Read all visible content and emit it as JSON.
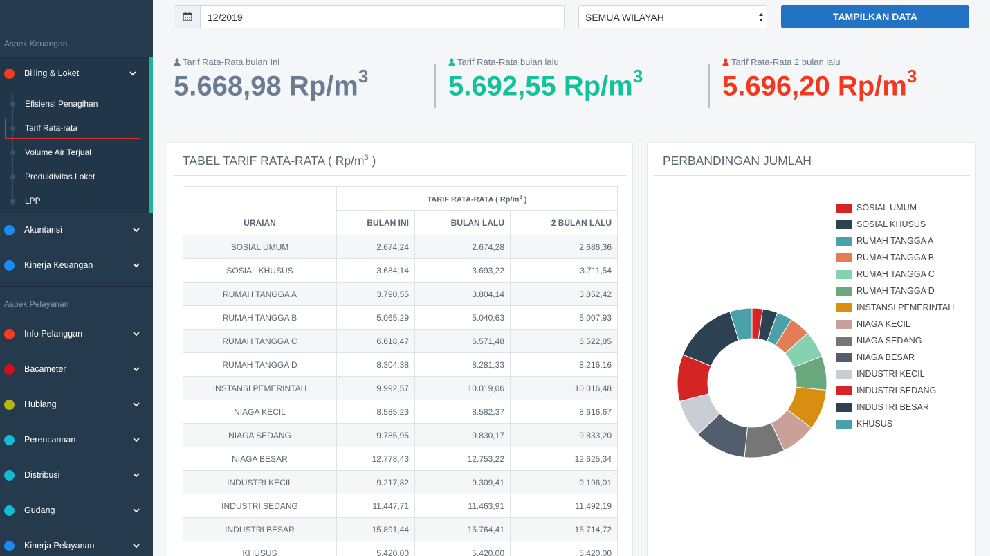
{
  "sidebar": {
    "section_keuangan": "Aspek Keuangan",
    "section_pelayanan": "Aspek Pelayanan",
    "billing": {
      "label": "Billing & Loket",
      "color": "#f63b1f"
    },
    "billing_sub": [
      "Efisiensi Penagihan",
      "Tarif Rata-rata",
      "Volume Air Terjual",
      "Produktivitas Loket",
      "LPP"
    ],
    "keuangan_items": [
      {
        "label": "Akuntansi",
        "color": "#1a8cf0"
      },
      {
        "label": "Kinerja Keuangan",
        "color": "#1a8cf0"
      }
    ],
    "pelayanan_items": [
      {
        "label": "Info Pelanggan",
        "color": "#f63b1f"
      },
      {
        "label": "Bacameter",
        "color": "#d0101a"
      },
      {
        "label": "Hublang",
        "color": "#b5b612"
      },
      {
        "label": "Perencanaan",
        "color": "#13bcd4"
      },
      {
        "label": "Distribusi",
        "color": "#13bcd4"
      },
      {
        "label": "Gudang",
        "color": "#13bcd4"
      },
      {
        "label": "Kinerja Pelayanan",
        "color": "#1a8cf0"
      }
    ]
  },
  "filters": {
    "date": "12/2019",
    "wilayah": "SEMUA WILAYAH",
    "button": "TAMPILKAN DATA"
  },
  "stats": [
    {
      "caption": "Tarif Rata-Rata bulan Ini",
      "value": "5.668,98 Rp/m",
      "sup": "3",
      "color": "#6b7b92"
    },
    {
      "caption": "Tarif Rata-Rata bulan lalu",
      "value": "5.692,55 Rp/m",
      "sup": "3",
      "color": "#13c19a"
    },
    {
      "caption": "Tarif Rata-Rata 2 bulan lalu",
      "value": "5.696,20 Rp/m",
      "sup": "3",
      "color": "#f2391f"
    }
  ],
  "table_panel": {
    "title": "TABEL TARIF RATA-RATA ( Rp/m",
    "title_sup": "3",
    "title_end": " )",
    "group_header": "TARIF RATA-RATA ( Rp/m",
    "group_sup": "3",
    "group_end": " )",
    "columns": [
      "URAIAN",
      "BULAN INI",
      "BULAN LALU",
      "2 BULAN LALU"
    ],
    "rows": [
      [
        "SOSIAL UMUM",
        "2.674,24",
        "2.674,28",
        "2.686,36"
      ],
      [
        "SOSIAL KHUSUS",
        "3.684,14",
        "3.693,22",
        "3.711,54"
      ],
      [
        "RUMAH TANGGA A",
        "3.790,55",
        "3.804,14",
        "3.852,42"
      ],
      [
        "RUMAH TANGGA B",
        "5.065,29",
        "5.040,63",
        "5.007,93"
      ],
      [
        "RUMAH TANGGA C",
        "6.618,47",
        "6.571,48",
        "6.522,85"
      ],
      [
        "RUMAH TANGGA D",
        "8.304,38",
        "8.281,33",
        "8.216,16"
      ],
      [
        "INSTANSI PEMERINTAH",
        "9.992,57",
        "10.019,06",
        "10.016,48"
      ],
      [
        "NIAGA KECIL",
        "8.585,23",
        "8.582,37",
        "8.616,67"
      ],
      [
        "NIAGA SEDANG",
        "9.785,95",
        "9.830,17",
        "9.833,20"
      ],
      [
        "NIAGA BESAR",
        "12.778,43",
        "12.753,22",
        "12.625,34"
      ],
      [
        "INDUSTRI KECIL",
        "9.217,82",
        "9.309,41",
        "9.196,01"
      ],
      [
        "INDUSTRI SEDANG",
        "11.447,71",
        "11.463,91",
        "11.492,19"
      ],
      [
        "INDUSTRI BESAR",
        "15.891,44",
        "15.764,41",
        "15.714,72"
      ],
      [
        "KHUSUS",
        "5.420,00",
        "5.420,00",
        "5.420,00"
      ]
    ]
  },
  "chart_panel": {
    "title": "PERBANDINGAN JUMLAH"
  },
  "chart_data": {
    "type": "pie",
    "donut": true,
    "categories": [
      "SOSIAL UMUM",
      "SOSIAL KHUSUS",
      "RUMAH TANGGA A",
      "RUMAH TANGGA B",
      "RUMAH TANGGA C",
      "RUMAH TANGGA D",
      "INSTANSI PEMERINTAH",
      "NIAGA KECIL",
      "NIAGA SEDANG",
      "NIAGA BESAR",
      "INDUSTRI KECIL",
      "INDUSTRI SEDANG",
      "INDUSTRI BESAR",
      "KHUSUS"
    ],
    "values": [
      2.2,
      3.1,
      3.2,
      4.3,
      5.6,
      7.0,
      8.4,
      7.3,
      8.3,
      10.8,
      7.8,
      9.7,
      13.4,
      4.6
    ],
    "colors": [
      "#d42424",
      "#2c4253",
      "#4aa1aa",
      "#e37d57",
      "#86d1b0",
      "#6aa77c",
      "#d88e10",
      "#c9a199",
      "#767676",
      "#515e6b",
      "#c7cdd3",
      "#d42424",
      "#2c4253",
      "#4aa1aa"
    ],
    "legend": "right"
  }
}
